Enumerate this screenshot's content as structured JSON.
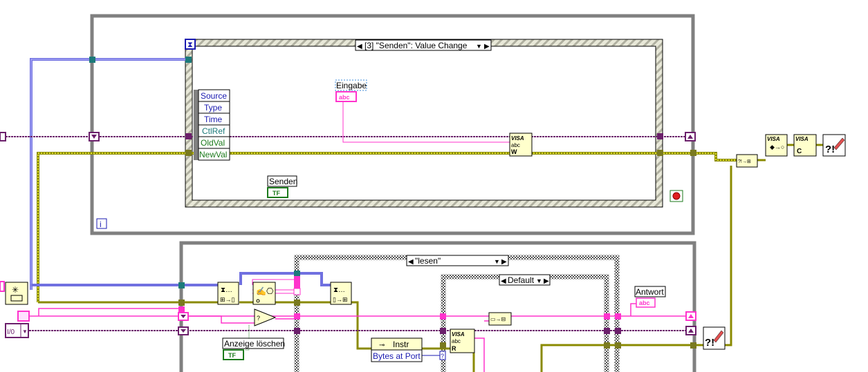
{
  "event_structure": {
    "case_selector": "[3] \"Senden\": Value Change",
    "event_data_fields": [
      "Source",
      "Type",
      "Time",
      "CtlRef",
      "OldVal",
      "NewVal"
    ]
  },
  "controls": {
    "eingabe": {
      "label": "Eingabe",
      "terminal": "abc"
    },
    "senden": {
      "label": "Senden",
      "terminal": "TF"
    },
    "anzeige_loeschen": {
      "label": "Anzeige löschen",
      "terminal": "TF"
    },
    "antwort": {
      "label": "Antwort",
      "terminal": "abc"
    }
  },
  "case_structures": {
    "outer_selector": "\"lesen\"",
    "inner_selector": "Default"
  },
  "property_node": {
    "class": "Instr",
    "property": "Bytes at Port"
  },
  "nodes": {
    "visa_write": {
      "title": "VISA",
      "line2": "abc",
      "mode": "W"
    },
    "visa_read": {
      "title": "VISA",
      "line2": "abc",
      "mode": "R"
    },
    "visa_close": {
      "title": "VISA"
    },
    "visa_clear": {
      "title": "VISA",
      "sub": "C"
    },
    "enum_constant": "I/0",
    "iteration_terminal": "i",
    "unknown_terminal": "?"
  },
  "colors": {
    "string_wire": "#ff33cc",
    "refnum_wire": "#6b1f6b",
    "error_wire": "#c8c800",
    "queue_wire": "#7070e0",
    "loop_border": "#808080",
    "node_fill": "#ffffcc"
  }
}
